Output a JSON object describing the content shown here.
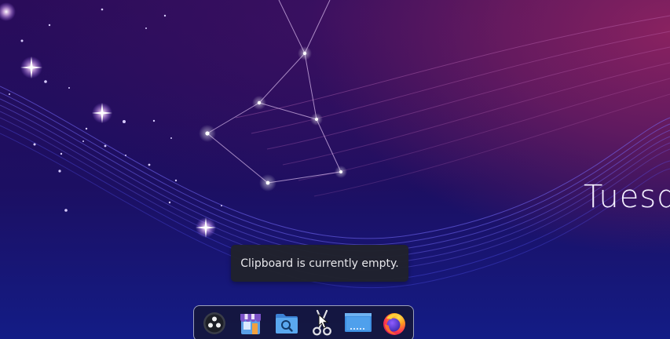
{
  "desktop": {
    "date_text": "Tuesd"
  },
  "tooltip": {
    "text": "Clipboard is currently empty."
  },
  "dock": {
    "items": [
      {
        "icon": "app-launcher-icon"
      },
      {
        "icon": "software-store-icon"
      },
      {
        "icon": "file-manager-icon"
      },
      {
        "icon": "clipboard-scissors-icon"
      },
      {
        "icon": "screenshot-tool-icon"
      },
      {
        "icon": "firefox-icon"
      }
    ]
  },
  "colors": {
    "tooltip_bg": "#20222c",
    "tooltip_text": "#e8e8ec",
    "dock_border": "#c8cde1",
    "wallpaper_top": "#2a0c5a",
    "wallpaper_bottom": "#131c86",
    "wallpaper_accent": "#8a2260"
  }
}
